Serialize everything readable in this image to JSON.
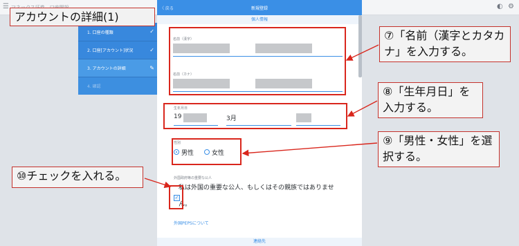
{
  "topbar": {
    "menu_icon": "☰",
    "crumbs": "マネックス証券　口座開設",
    "icon_contrast": "◐",
    "icon_settings": "⚙"
  },
  "annotation_title": "アカウントの詳細(1)",
  "steps": [
    {
      "label": "1. 口座の種類",
      "mark": "✓"
    },
    {
      "label": "2. 口座[アカウント]状況",
      "mark": "✓"
    },
    {
      "label": "3. アカウントの詳細",
      "mark": "✎"
    },
    {
      "label": "4. 確認",
      "mark": ""
    }
  ],
  "panel": {
    "back": "〈 戻る",
    "title": "新規登録",
    "section": "個人情報",
    "name_kanji_label": "名前（漢字）",
    "name_kana_label": "名前（カナ）",
    "birth_label": "生年月日",
    "birth_year": "19",
    "birth_month": "3月",
    "gender_label": "性別",
    "gender_male": "男性",
    "gender_female": "女性",
    "peps_label": "外国政府等の重要な公人",
    "peps_text_1": "私は外国の重要な公人、もしくはその親族ではありませ",
    "peps_text_2": "ん。",
    "peps_link": "外国PEPSについて",
    "footer": "連絡先"
  },
  "callouts": {
    "c7": "⑦「名前（漢字とカタカナ」を入力する。",
    "c8": "⑧「生年月日」を入力する。",
    "c9": "⑨「男性・女性」を選択する。",
    "c10": "⑩チェックを入れる。"
  },
  "colors": {
    "accent": "#3a8fe6",
    "annotation_red": "#d9261c"
  }
}
